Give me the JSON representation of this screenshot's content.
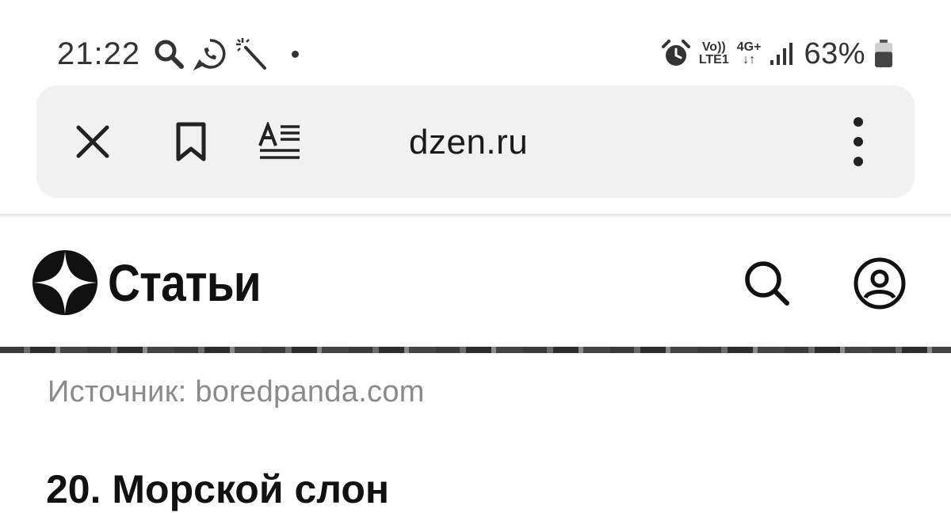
{
  "status_bar": {
    "time": "21:22",
    "left_icons": [
      "search-icon",
      "whatsapp-icon",
      "magic-wand-icon",
      "dot-icon"
    ],
    "alarm_icon": "alarm-icon",
    "volte_line1": "Vo))",
    "volte_line2": "LTE1",
    "network_line1": "4G+",
    "network_line2": "↓↑",
    "signal_icon": "signal-icon",
    "battery_percent": "63%",
    "battery_level": 0.63
  },
  "browser": {
    "url": "dzen.ru",
    "buttons": [
      "close-icon",
      "bookmark-icon",
      "reader-mode-icon",
      "more-vert-icon"
    ]
  },
  "site_header": {
    "title": "Статьи",
    "logo_icon": "dzen-star-logo",
    "search_icon": "search-icon",
    "profile_icon": "user-profile-icon"
  },
  "article": {
    "source": "Источник: boredpanda.com",
    "heading": "20. Морской слон"
  }
}
